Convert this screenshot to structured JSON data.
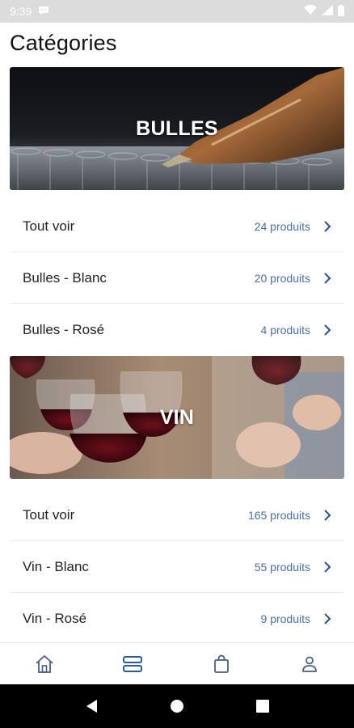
{
  "status_bar": {
    "time": "9:39",
    "icons": [
      "notification-icon",
      "wifi-icon",
      "signal-icon",
      "battery-icon"
    ]
  },
  "page": {
    "title": "Catégories"
  },
  "sections": [
    {
      "banner_label": "BULLES",
      "items": [
        {
          "name": "Tout voir",
          "count": "24 produits"
        },
        {
          "name": "Bulles - Blanc",
          "count": "20 produits"
        },
        {
          "name": "Bulles - Rosé",
          "count": "4 produits"
        }
      ]
    },
    {
      "banner_label": "VIN",
      "items": [
        {
          "name": "Tout voir",
          "count": "165 produits"
        },
        {
          "name": "Vin - Blanc",
          "count": "55 produits"
        },
        {
          "name": "Vin - Rosé",
          "count": "9 produits"
        }
      ]
    }
  ],
  "bottom_nav": {
    "items": [
      "home-icon",
      "categories-icon",
      "shopping-bag-icon",
      "profile-icon"
    ],
    "active_color": "#2b5aa8",
    "inactive_color": "#4a5f80"
  },
  "colors": {
    "accent": "#4a6fa8"
  }
}
